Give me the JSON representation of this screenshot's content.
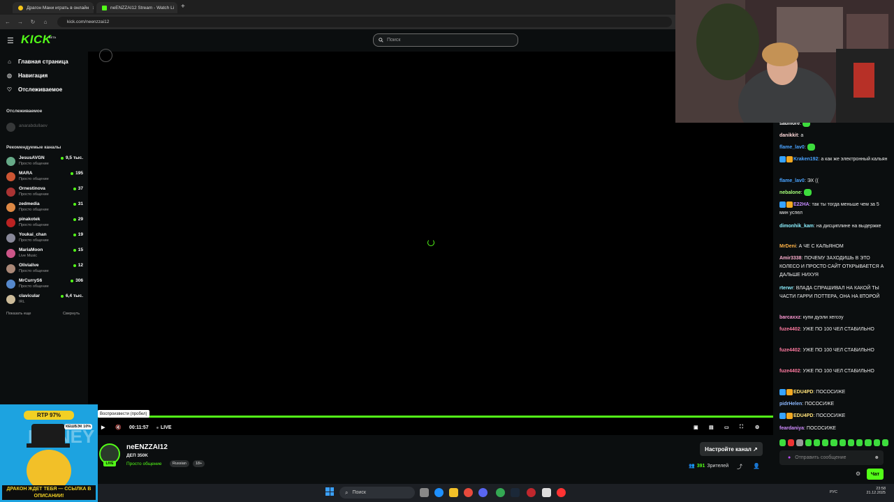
{
  "browser": {
    "tabs": [
      {
        "title": "Драгон Мани играть в онлайн",
        "active": false
      },
      {
        "title": "neENZZAI12 Stream - Watch Li",
        "active": true
      }
    ],
    "url": "kick.com/neenzzai12"
  },
  "header": {
    "logo": "KICK",
    "logo_badge": "BETA",
    "search_placeholder": "Поиск"
  },
  "sidebar": {
    "nav": [
      {
        "label": "Главная страница",
        "icon": "home-icon"
      },
      {
        "label": "Навигация",
        "icon": "compass-icon"
      },
      {
        "label": "Отслеживаемое",
        "icon": "heart-icon"
      }
    ],
    "following_title": "Отслеживаемое",
    "following": [
      {
        "name": "anarabdullaev"
      }
    ],
    "recommended_title": "Рекомендуемые каналы",
    "channels": [
      {
        "name": "JesusAVGN",
        "category": "Просто общение",
        "viewers": "9,5 тыс."
      },
      {
        "name": "MARA",
        "category": "Просто общение",
        "viewers": "195"
      },
      {
        "name": "Ornestinova",
        "category": "Просто общение",
        "viewers": "37"
      },
      {
        "name": "zedmedia",
        "category": "Просто общение",
        "viewers": "31"
      },
      {
        "name": "pinakotek",
        "category": "Просто общение",
        "viewers": "29"
      },
      {
        "name": "Youkai_chan",
        "category": "Просто общение",
        "viewers": "19"
      },
      {
        "name": "MariaMoon",
        "category": "Live Music",
        "viewers": "15"
      },
      {
        "name": "Olivialive",
        "category": "Просто общение",
        "viewers": "12"
      },
      {
        "name": "MrCurryS6",
        "category": "Просто общение",
        "viewers": "306"
      },
      {
        "name": "clavicular",
        "category": "IRL",
        "viewers": "6,4 тыс."
      }
    ],
    "show_more": "Показать еще",
    "collapse": "Свернуть"
  },
  "player": {
    "tooltip": "Воспроизвести (пробел)",
    "time": "00:11:57",
    "live": "LIVE"
  },
  "stream": {
    "name": "neENZZAI12",
    "title": "ДЕП 350K",
    "category": "Просто общение",
    "tags": [
      "Russian",
      "18+"
    ],
    "live_badge": "LIVE",
    "configure_button": "Настройте канал",
    "viewer_count": "391",
    "viewer_label": "Зрителей"
  },
  "chat": {
    "messages": [
      {
        "user": "sadmore",
        "color": "#ffffff",
        "text": "",
        "emote": true
      },
      {
        "user": "danikkit",
        "color": "#ffd9d9",
        "text": "a"
      },
      {
        "user": "flame_lav0",
        "color": "#4aa3ff",
        "text": "",
        "emote": true
      },
      {
        "user": "Kraken192",
        "color": "#4aa3ff",
        "text": "а как же электронный кальян",
        "badge": true
      },
      {
        "user": "flame_lav0",
        "color": "#4aa3ff",
        "text": "ЭХ (("
      },
      {
        "user": "nebalone",
        "color": "#a6ff7a",
        "text": "",
        "emote": true
      },
      {
        "user": "E22HA",
        "color": "#c58cff",
        "text": "так ты тогда меньше чем за 5 мин успел",
        "badge": true
      },
      {
        "user": "dimonhik_kam",
        "color": "#8cf0ff",
        "text": "на дисциплине на выдержке"
      },
      {
        "user": "MrDeni",
        "color": "#ffb347",
        "text": "А ЧЕ С КАЛЬЯНОМ"
      },
      {
        "user": "Amir3338",
        "color": "#ffb0d0",
        "text": "ПОЧЕМУ ЗАХОДИШЬ В ЭТО КОЛЕСО И ПРОСТО САЙТ ОТКРЫВАЕТСЯ А ДАЛЬШЕ НИХУЯ"
      },
      {
        "user": "rterwr",
        "color": "#8cf0ff",
        "text": "ВЛАДА СПРАШИВАЛ НА КАКОЙ ТЫ ЧАСТИ ГАРРИ ПОТТЕРА, ОНА НА ВТОРОЙ"
      },
      {
        "user": "barcaxxz",
        "color": "#ff9ad5",
        "text": "купи дуэли хегсоу"
      },
      {
        "user": "fuze4402",
        "color": "#ff7aa0",
        "text": "УЖЕ ПО 100 ЧЕЛ СТАБИЛЬНО"
      },
      {
        "user": "fuze4402",
        "color": "#ff7aa0",
        "text": "УЖЕ ПО 100 ЧЕЛ СТАБИЛЬНО"
      },
      {
        "user": "fuze4402",
        "color": "#ff7aa0",
        "text": "УЖЕ ПО 100 ЧЕЛ СТАБИЛЬНО"
      },
      {
        "user": "EDU4PD",
        "color": "#ffe27a",
        "text": "ПОСОСИЖЕ",
        "badge": true
      },
      {
        "user": "pidrHelen",
        "color": "#8cb8ff",
        "text": "ПОСОСИЖЕ"
      },
      {
        "user": "EDU4PD",
        "color": "#ffe27a",
        "text": "ПОСОСИЖЕ",
        "badge": true
      },
      {
        "user": "feardaniya",
        "color": "#d08cff",
        "text": "ПОСОСИЖЕ"
      }
    ],
    "input_placeholder": "Отправить сообщение",
    "send_button": "Чат"
  },
  "ad": {
    "rtp": "RTP 97%",
    "cashback": "КЕШБЭК 10%",
    "bottom": "ДРАКОН ЖДЕТ ТЕБЯ — ССЫЛКА В ОПИСАНИИ!"
  },
  "taskbar": {
    "search": "Поиск",
    "lang": "РУС",
    "time": "23:58",
    "date": "21.12.2025"
  },
  "colors": {
    "accent": "#53fc18",
    "background": "#0b0e0f"
  }
}
